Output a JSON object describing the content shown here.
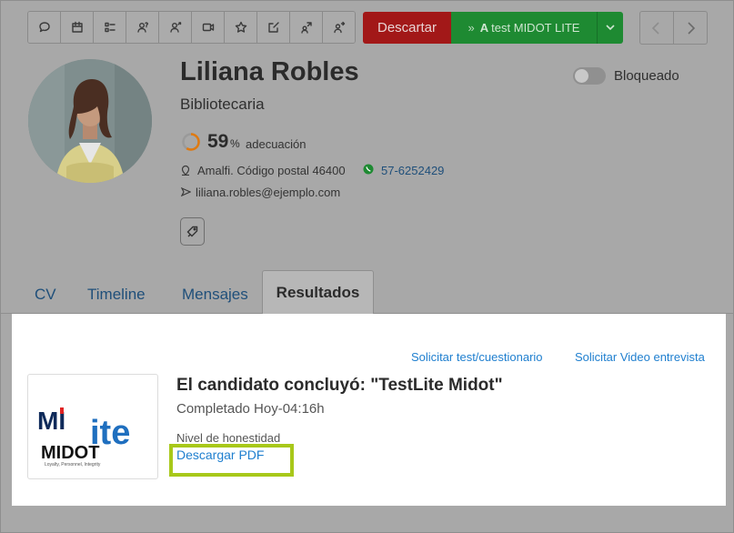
{
  "toolbar": {
    "icons": [
      "chat-icon",
      "calendar-icon",
      "checklist-icon",
      "user-question-icon",
      "user-share-icon",
      "video-icon",
      "star-icon",
      "edit-icon",
      "user-transfer-icon",
      "user-forward-icon"
    ]
  },
  "actions": {
    "discard_label": "Descartar",
    "test_prefix": "A",
    "test_label": "test MIDOT LITE"
  },
  "profile": {
    "name": "Liliana Robles",
    "role": "Bibliotecaria",
    "score": "59",
    "score_unit": "%",
    "score_label": "adecuación",
    "score_fraction": 0.59,
    "location": "Amalfi. Código postal 46400",
    "phone": "57-6252429",
    "email": "liliana.robles@ejemplo.com",
    "blocked_label": "Bloqueado",
    "blocked": false
  },
  "tabs": [
    {
      "label": "CV"
    },
    {
      "label": "Timeline"
    },
    {
      "label": "Mensajes"
    },
    {
      "label": "Resultados"
    }
  ],
  "results": {
    "request_test": "Solicitar test/cuestionario",
    "request_video": "Solicitar Video entrevista",
    "logo_text_top": "MI",
    "logo_text_ite": "ite",
    "logo_text_midot": "MIDOT",
    "logo_tagline": "Loyalty, Personnel, Integrity",
    "concluded": "El candidato concluyó: \"TestLite Midot\"",
    "completed": "Completado Hoy-04:16h",
    "honesty_label": "Nivel de honestidad",
    "download_pdf": "Descargar PDF"
  },
  "colors": {
    "discard": "#a21818",
    "test": "#1e8a32",
    "score_ring": "#e07a10",
    "link": "#1f7fcf",
    "highlight": "#a8c81a"
  }
}
